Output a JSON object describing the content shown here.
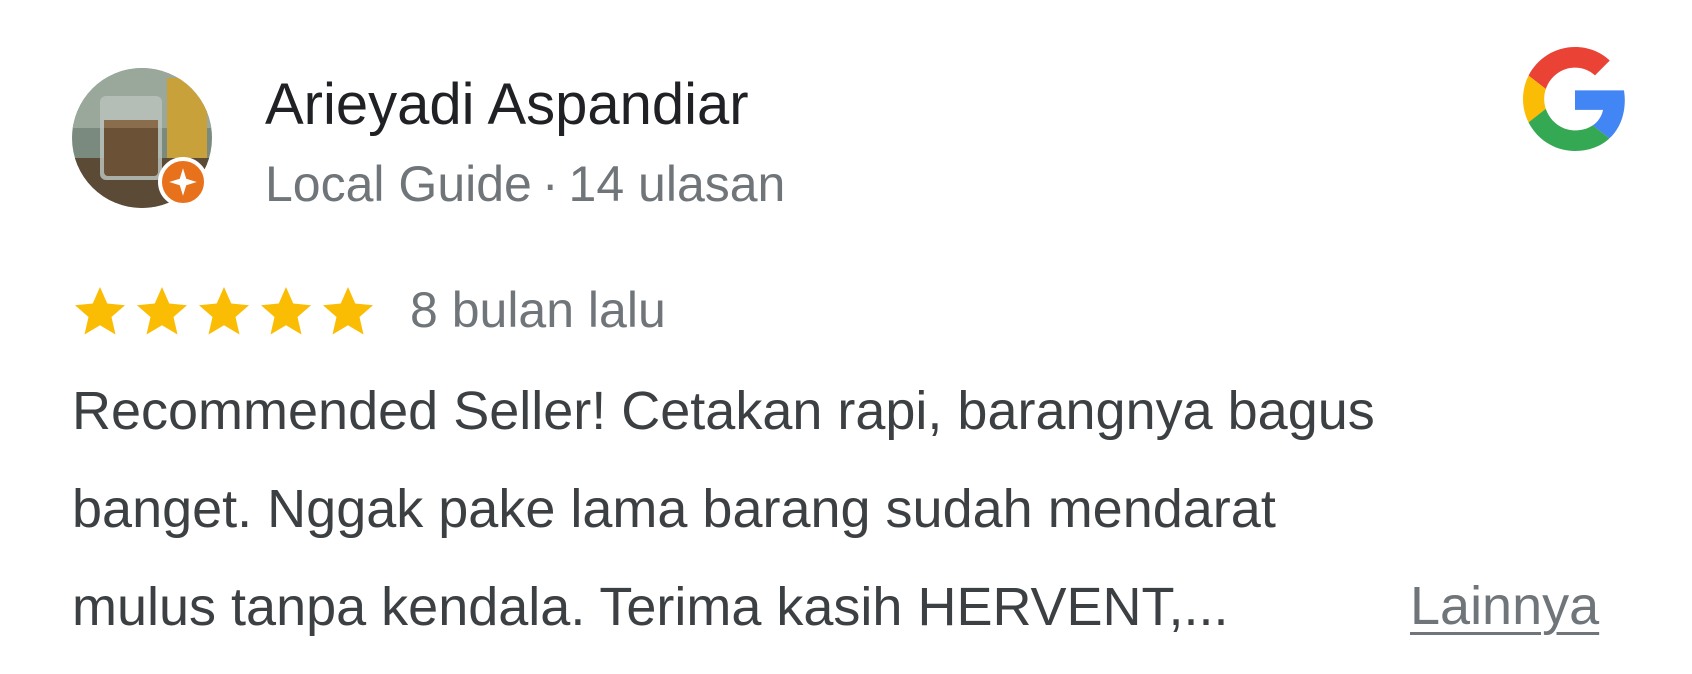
{
  "reviewer": {
    "name": "Arieyadi Aspandiar",
    "badge": "Local Guide",
    "separator": "·",
    "review_count": "14 ulasan",
    "avatar_icon": "avatar-photo",
    "badge_icon": "local-guide-star-icon",
    "badge_color": "#e8711c"
  },
  "brand": {
    "logo_icon": "google-g-logo",
    "colors": {
      "blue": "#4285F4",
      "red": "#EA4335",
      "yellow": "#FBBC05",
      "green": "#34A853"
    }
  },
  "review": {
    "rating": 5,
    "rating_max": 5,
    "star_color": "#fbbc04",
    "date": "8 bulan lalu",
    "text_lines": [
      "Recommended Seller! Cetakan rapi, barangnya bagus",
      "banget. Nggak pake lama barang sudah mendarat",
      "mulus tanpa kendala. Terima kasih HERVENT,..."
    ],
    "more_label": "Lainnya"
  }
}
